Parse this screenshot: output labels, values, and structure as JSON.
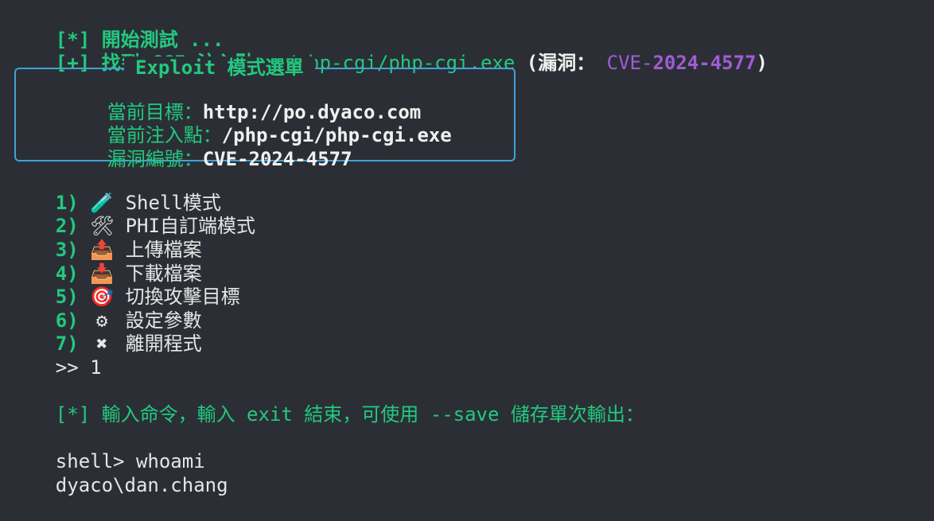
{
  "header": {
    "line1_tag": "[*]",
    "line1_text": " 開始測試 ...",
    "line2_tag": "[+]",
    "line2_label": " 找到 CGI 注入點：",
    "line2_path": " /php-cgi/php-cgi.exe",
    "line2_open": " (漏洞：",
    "line2_cve_prefix": " CVE-",
    "line2_cve_number": "2024-4577",
    "line2_close": ")"
  },
  "panel": {
    "title": "Exploit 模式選單",
    "rows": [
      {
        "label": "當前目標：",
        "value": "http://po.dyaco.com"
      },
      {
        "label": "當前注入點：",
        "value": "/php-cgi/php-cgi.exe"
      },
      {
        "label": "漏洞編號：",
        "value": "CVE-2024-4577"
      }
    ]
  },
  "menu": {
    "items": [
      {
        "num": "1)",
        "icon": "🧪",
        "icon_name": "test-tube-icon",
        "label": "Shell模式"
      },
      {
        "num": "2)",
        "icon": "🛠",
        "icon_name": "tools-icon",
        "label": "PHI自訂端模式"
      },
      {
        "num": "3)",
        "icon": "📤",
        "icon_name": "upload-tray-icon",
        "label": "上傳檔案"
      },
      {
        "num": "4)",
        "icon": "📥",
        "icon_name": "download-tray-icon",
        "label": "下載檔案"
      },
      {
        "num": "5)",
        "icon": "🎯",
        "icon_name": "target-icon",
        "label": "切換攻擊目標"
      },
      {
        "num": "6)",
        "icon": "⚙",
        "icon_name": "gear-icon",
        "label": "設定參數"
      },
      {
        "num": "7)",
        "icon": "✖",
        "icon_name": "cross-icon",
        "label": "離開程式"
      }
    ],
    "prompt": ">> ",
    "selection": "1"
  },
  "shell": {
    "info_tag": "[*]",
    "info_text": " 輸入命令，輸入 exit 結束，可使用 --save 儲存單次輸出：",
    "prompt": "shell> ",
    "command": "whoami",
    "output": "dyaco\\dan.chang"
  },
  "colors": {
    "background": "#2b2f35",
    "green": "#22c97f",
    "purple": "#a15bd8",
    "border": "#3fa1d6",
    "text": "#e6e6e6"
  }
}
